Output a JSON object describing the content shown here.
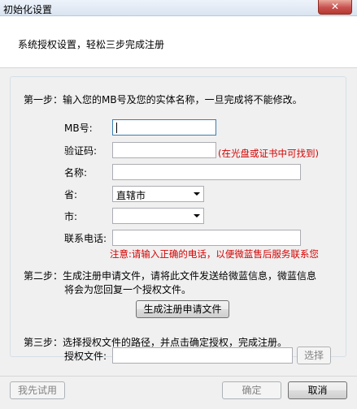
{
  "window": {
    "title": "初始化设置",
    "close": "✕"
  },
  "header": {
    "subtitle": "系统授权设置，轻松三步完成注册"
  },
  "step1": {
    "text": "第一步：输入您的MB号及您的实体名称，一旦完成将不能修改。",
    "mb_label": "MB号:",
    "mb_value": "",
    "code_label": "验证码:",
    "code_value": "",
    "code_hint": "(在光盘或证书中可找到)",
    "name_label": "名称:",
    "name_value": "",
    "province_label": "省:",
    "province_value": "直辖市",
    "city_label": "市:",
    "city_value": "",
    "phone_label": "联系电话:",
    "phone_value": "",
    "phone_hint": "注意:请输入正确的电话，以便微蓝售后服务联系您"
  },
  "step2": {
    "line1": "第二步：生成注册申请文件，请将此文件发送给微蓝信息，微蓝信息",
    "line2": "将会为您回复一个授权文件。",
    "button": "生成注册申请文件"
  },
  "step3": {
    "text": "第三步：选择授权文件的路径，并点击确定授权，完成注册。",
    "file_label": "授权文件:",
    "file_value": "",
    "browse_button": "选择"
  },
  "footer": {
    "trial_button": "我先试用",
    "ok_button": "确定",
    "cancel_button": "取消"
  }
}
